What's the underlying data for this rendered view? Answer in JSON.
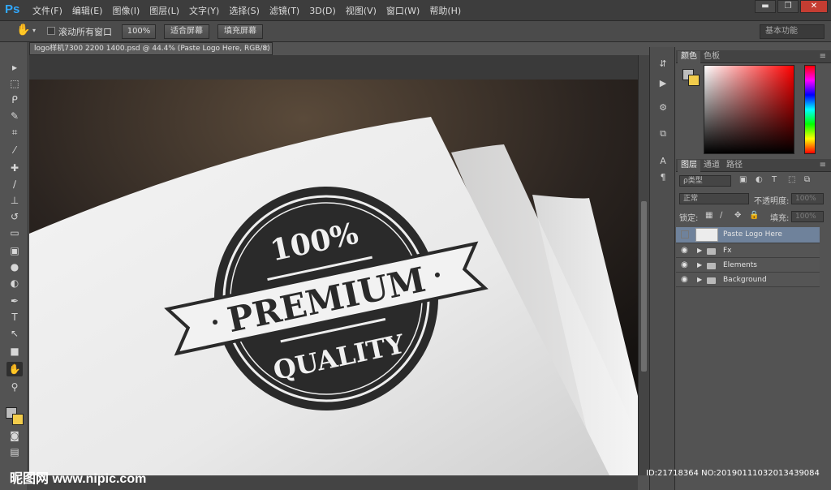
{
  "app": {
    "logo": "Ps",
    "menu": [
      "文件(F)",
      "编辑(E)",
      "图像(I)",
      "图层(L)",
      "文字(Y)",
      "选择(S)",
      "滤镜(T)",
      "3D(D)",
      "视图(V)",
      "窗口(W)",
      "帮助(H)"
    ],
    "window_controls": {
      "minimize": "▬",
      "restore": "❐",
      "close": "✕"
    }
  },
  "options_bar": {
    "scroll_all_windows": "滚动所有窗口",
    "zoom_100": "100%",
    "fit_screen": "适合屏幕",
    "fill_screen": "填充屏幕",
    "workspace": "基本功能"
  },
  "document": {
    "tab_title": "logo样机7300 2200 1400.psd @ 44.4% (Paste Logo Here, RGB/8)",
    "close": "×"
  },
  "artwork": {
    "line1": "100%",
    "line2": "PREMIUM",
    "line3": "QUALITY"
  },
  "panels": {
    "color_tabs": [
      "颜色",
      "色板"
    ],
    "layers_tabs": [
      "图层",
      "通道",
      "路径"
    ],
    "filter_kind": "ρ类型",
    "blend_mode": "正常",
    "opacity_label": "不透明度:",
    "opacity_value": "100%",
    "lock_label": "锁定:",
    "fill_label": "填充:",
    "fill_value": "100%",
    "layers": [
      {
        "name": "Paste Logo Here",
        "selected": true
      },
      {
        "name": "Fx",
        "selected": false
      },
      {
        "name": "Elements",
        "selected": false
      },
      {
        "name": "Background",
        "selected": false
      }
    ]
  },
  "colors": {
    "foreground": "#bdbdbd",
    "background": "#f2cc4b",
    "accent": "#31a8ff"
  },
  "watermark": {
    "left": "昵图网 www.nipic.com",
    "right": "ID:21718364 NO:20190111032013439084"
  }
}
